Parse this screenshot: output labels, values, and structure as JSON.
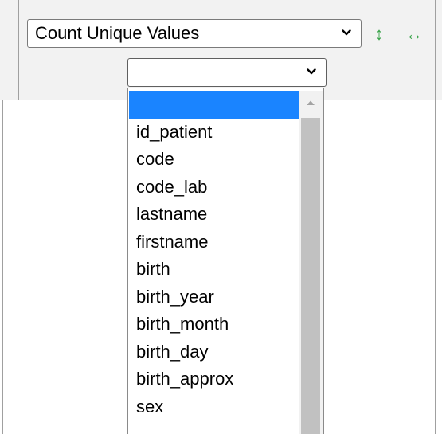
{
  "aggregator": {
    "selected": "Count Unique Values"
  },
  "controls": {
    "sort_icon": "vertical-arrows-icon",
    "flip_icon": "horizontal-arrows-icon",
    "sort_glyph": "↕",
    "flip_glyph": "↔"
  },
  "attribute_select": {
    "selected": ""
  },
  "dropdown": {
    "options": [
      "",
      "id_patient",
      "code",
      "code_lab",
      "lastname",
      "firstname",
      "birth",
      "birth_year",
      "birth_month",
      "birth_day",
      "birth_approx",
      "sex"
    ],
    "highlighted_index": 0
  },
  "colors": {
    "accent_green": "#3aa34a",
    "highlight_blue": "#1a84ff",
    "panel_bg": "#f2f2f2"
  }
}
